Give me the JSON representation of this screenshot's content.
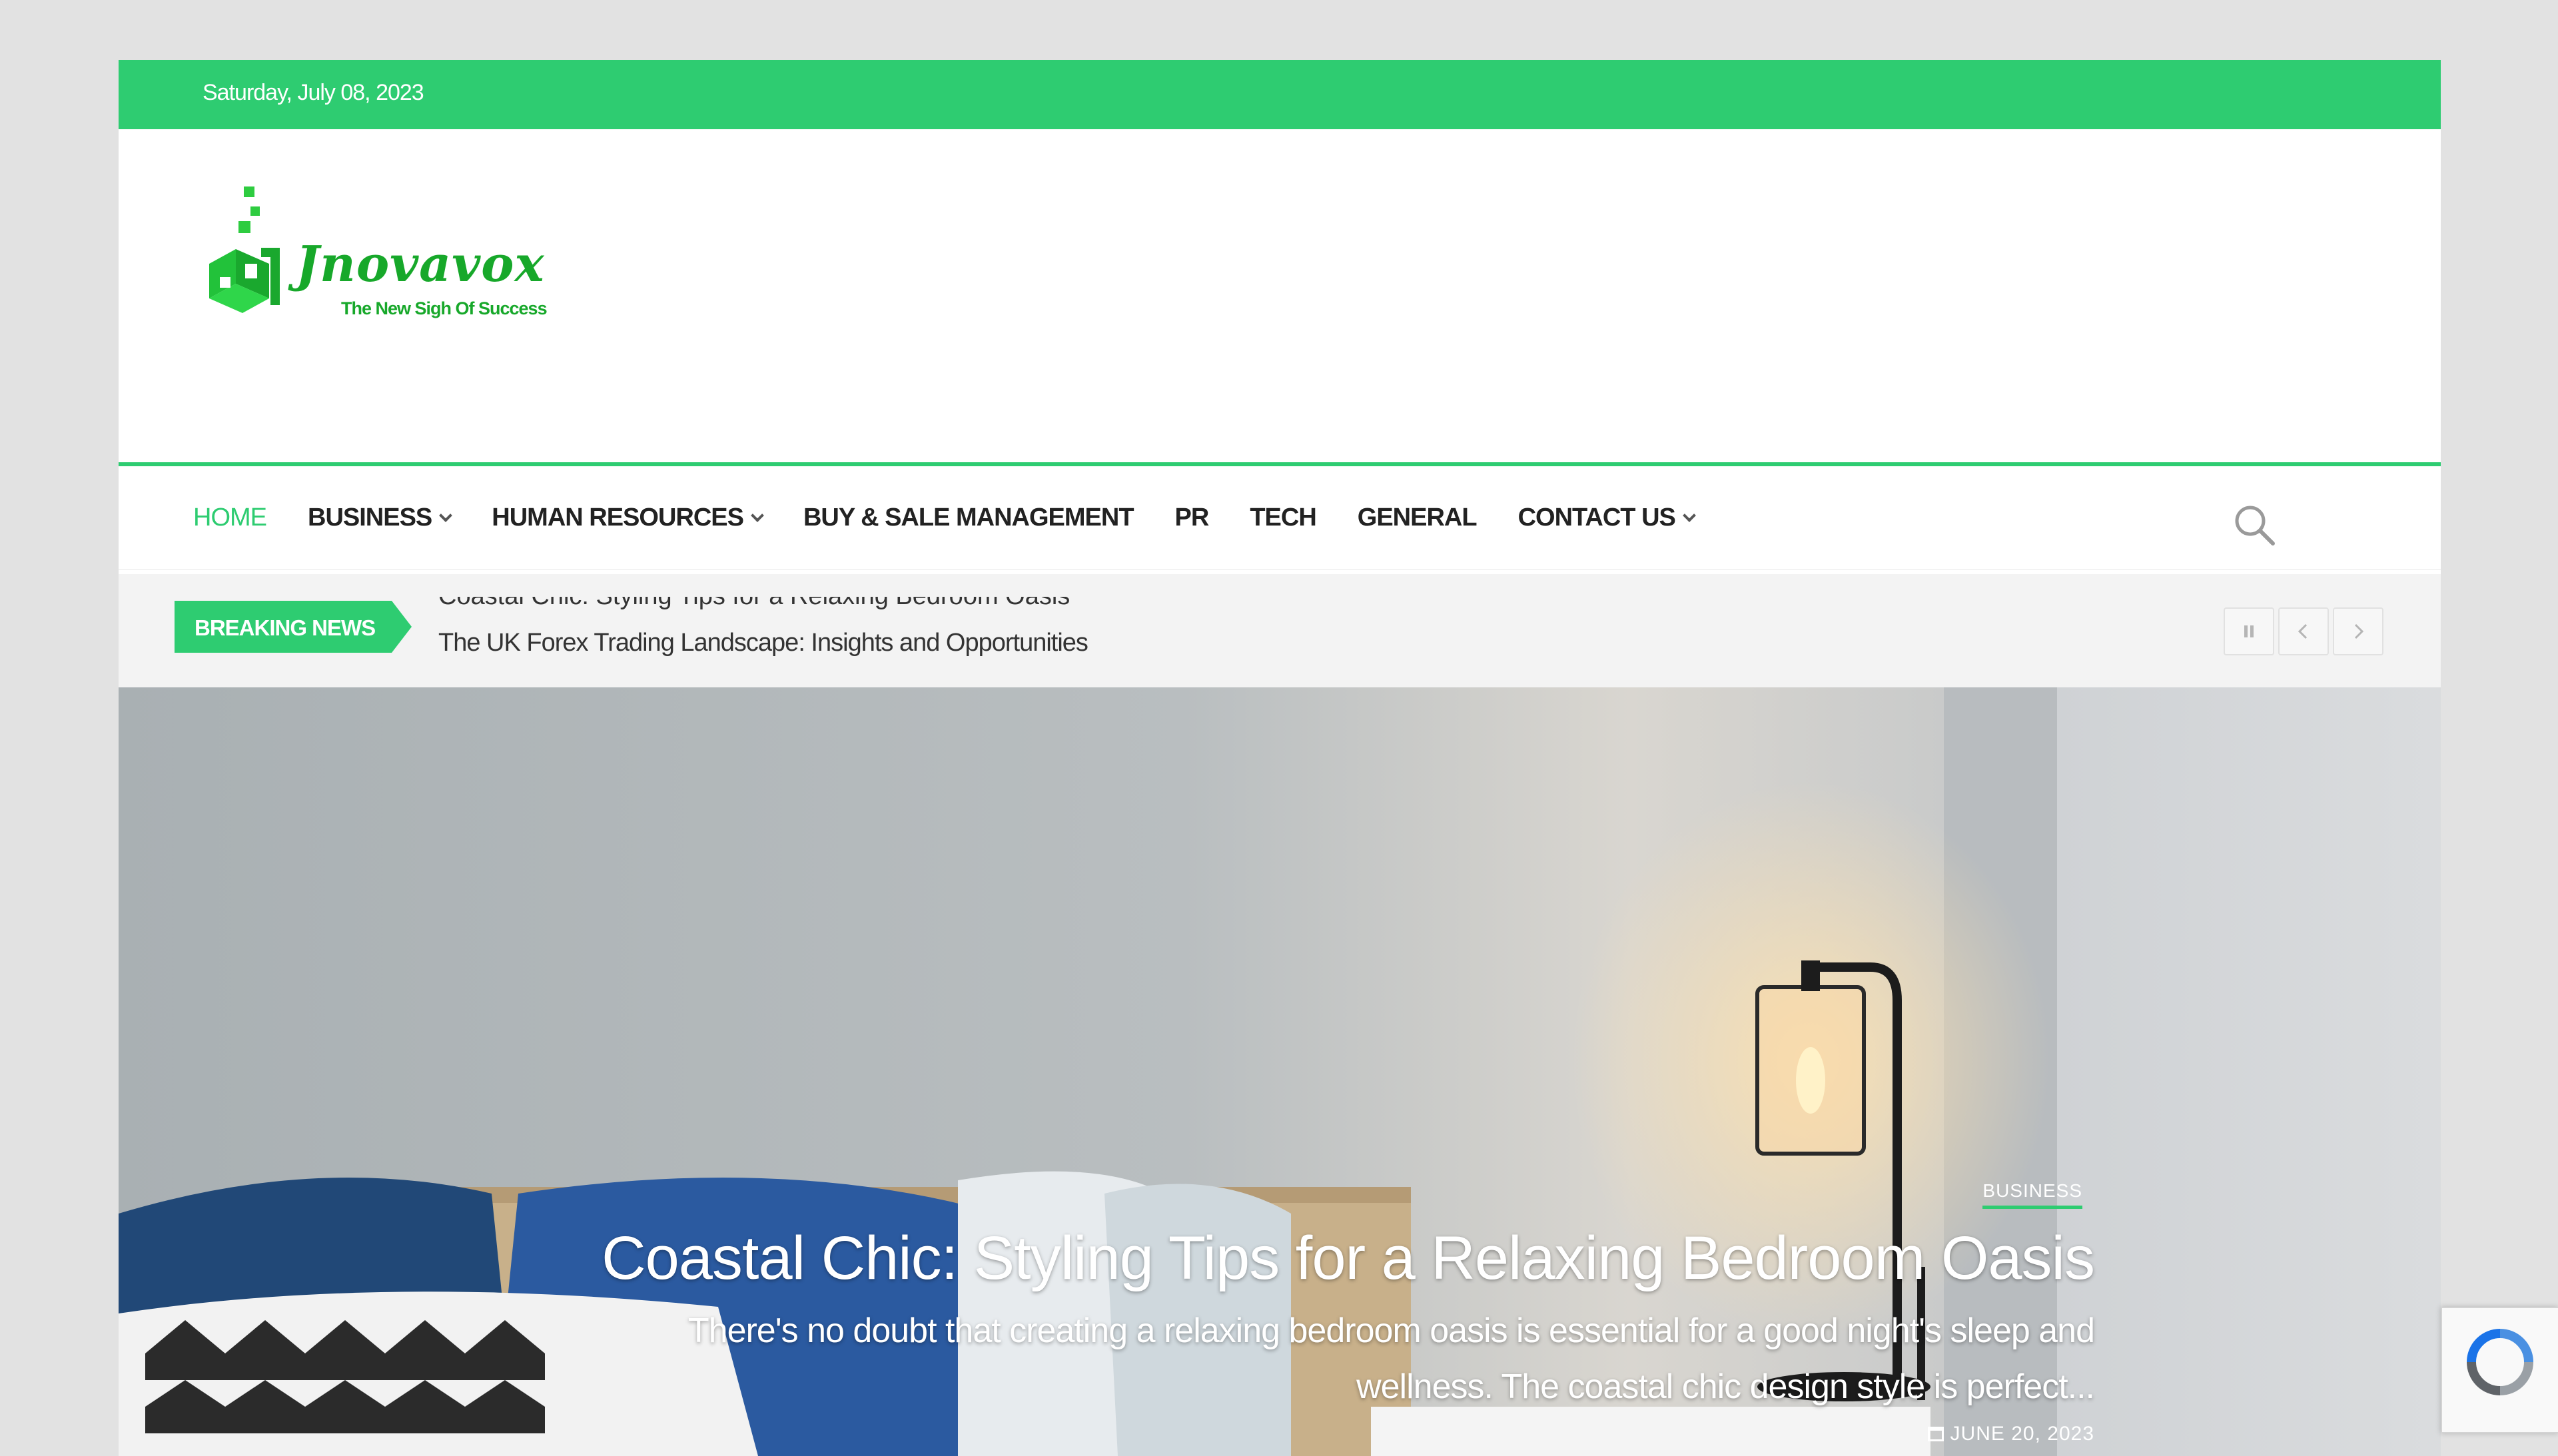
{
  "topbar": {
    "date": "Saturday, July 08, 2023"
  },
  "logo": {
    "brand": "Jnovavox",
    "tagline": "The New Sigh Of Success"
  },
  "nav": {
    "items": [
      {
        "label": "HOME",
        "active": true,
        "dropdown": false
      },
      {
        "label": "BUSINESS",
        "active": false,
        "dropdown": true
      },
      {
        "label": "HUMAN RESOURCES",
        "active": false,
        "dropdown": true
      },
      {
        "label": "BUY & SALE MANAGEMENT",
        "active": false,
        "dropdown": false
      },
      {
        "label": "PR",
        "active": false,
        "dropdown": false
      },
      {
        "label": "TECH",
        "active": false,
        "dropdown": false
      },
      {
        "label": "GENERAL",
        "active": false,
        "dropdown": false
      },
      {
        "label": "CONTACT US",
        "active": false,
        "dropdown": true
      }
    ],
    "search_icon": "search-icon"
  },
  "breaking": {
    "label": "BREAKING NEWS",
    "previous_headline": "Coastal Chic: Styling Tips for a Relaxing Bedroom Oasis",
    "current_headline": "The UK Forex Trading Landscape: Insights and Opportunities",
    "controls": [
      "pause-icon",
      "chevron-left-icon",
      "chevron-right-icon"
    ]
  },
  "hero": {
    "category": "BUSINESS",
    "title": "Coastal Chic: Styling Tips for a Relaxing Bedroom Oasis",
    "excerpt_line1": "There's no doubt that creating a relaxing bedroom oasis is essential for a good night's sleep and",
    "excerpt_line2": "wellness. The coastal chic design style is perfect...",
    "date": "JUNE 20, 2023"
  },
  "colors": {
    "accent": "#2ecc71",
    "logo_green": "#17a82a",
    "nav_text": "#222222"
  }
}
